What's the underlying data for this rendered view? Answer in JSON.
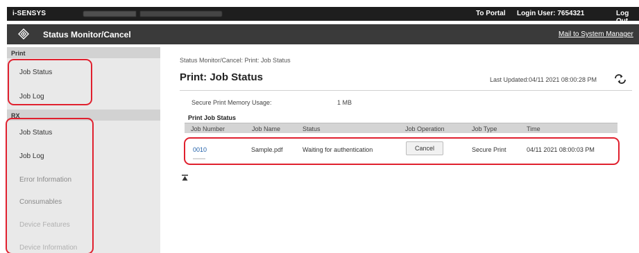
{
  "topbar": {
    "brand": "i-SENSYS",
    "to_portal": "To Portal",
    "login_user": "Login User:  7654321",
    "log_out": "Log Out"
  },
  "titlebar": {
    "title": "Status Monitor/Cancel",
    "mail_link": "Mail to System Manager"
  },
  "sidebar": {
    "print_header": "Print",
    "print_items": [
      "Job Status",
      "Job Log"
    ],
    "rx_header": "RX",
    "rx_items": [
      "Job Status",
      "Job Log",
      "Error Information",
      "Consumables",
      "Device Features",
      "Device Information"
    ]
  },
  "main": {
    "breadcrumb": "Status Monitor/Cancel: Print: Job Status",
    "title": "Print: Job Status",
    "last_updated": "Last Updated:04/11 2021 08:00:28 PM",
    "memory_label": "Secure Print Memory Usage:",
    "memory_value": "1 MB",
    "section_title": "Print Job Status",
    "columns": [
      "Job Number",
      "Job Name",
      "Status",
      "Job Operation",
      "Job Type",
      "Time"
    ],
    "row": {
      "job_number": "0010",
      "job_name": "Sample.pdf",
      "status": "Waiting for authentication",
      "operation": "Cancel",
      "job_type": "Secure Print",
      "time": "04/11 2021 08:00:03 PM"
    }
  },
  "colors": {
    "highlight": "#e0202e",
    "link": "#1f5fa8",
    "topbar": "#1e1e1e",
    "titlebar": "#3a3a3a"
  },
  "icons": [
    "canon-logo-icon",
    "refresh-icon",
    "back-to-top-icon"
  ]
}
